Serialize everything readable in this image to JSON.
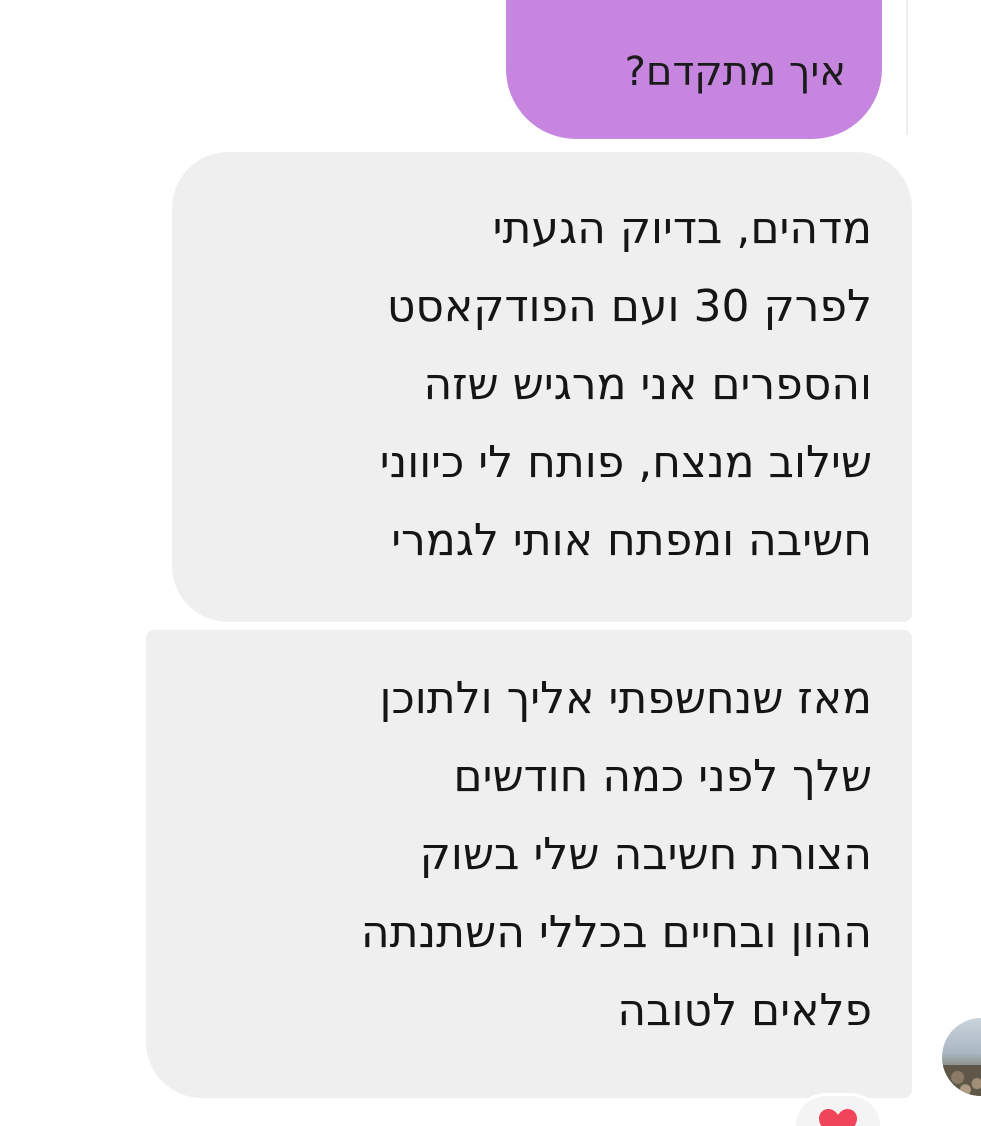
{
  "conversation": {
    "sent_message": {
      "text": "איך מתקדם?"
    },
    "received_messages": [
      {
        "lines": [
          "מדהים, בדיוק הגעתי",
          "לפרק 30 ועם הפודקאסט",
          "והספרים אני מרגיש שזה",
          "שילוב מנצח, פותח לי כיווני",
          "חשיבה ומפתח אותי לגמרי"
        ]
      },
      {
        "lines": [
          "מאז שנחשפתי אליך ולתוכן",
          "שלך לפני כמה חודשים",
          "הצורת חשיבה שלי בשוק",
          "ההון ובחיים בכללי השתנתה",
          "פלאים לטובה"
        ],
        "reaction": {
          "icon": "heart-icon",
          "color": "#f0445a"
        }
      }
    ],
    "colors": {
      "sent_bubble": "#c686e0",
      "received_bubble": "#efefef"
    }
  }
}
